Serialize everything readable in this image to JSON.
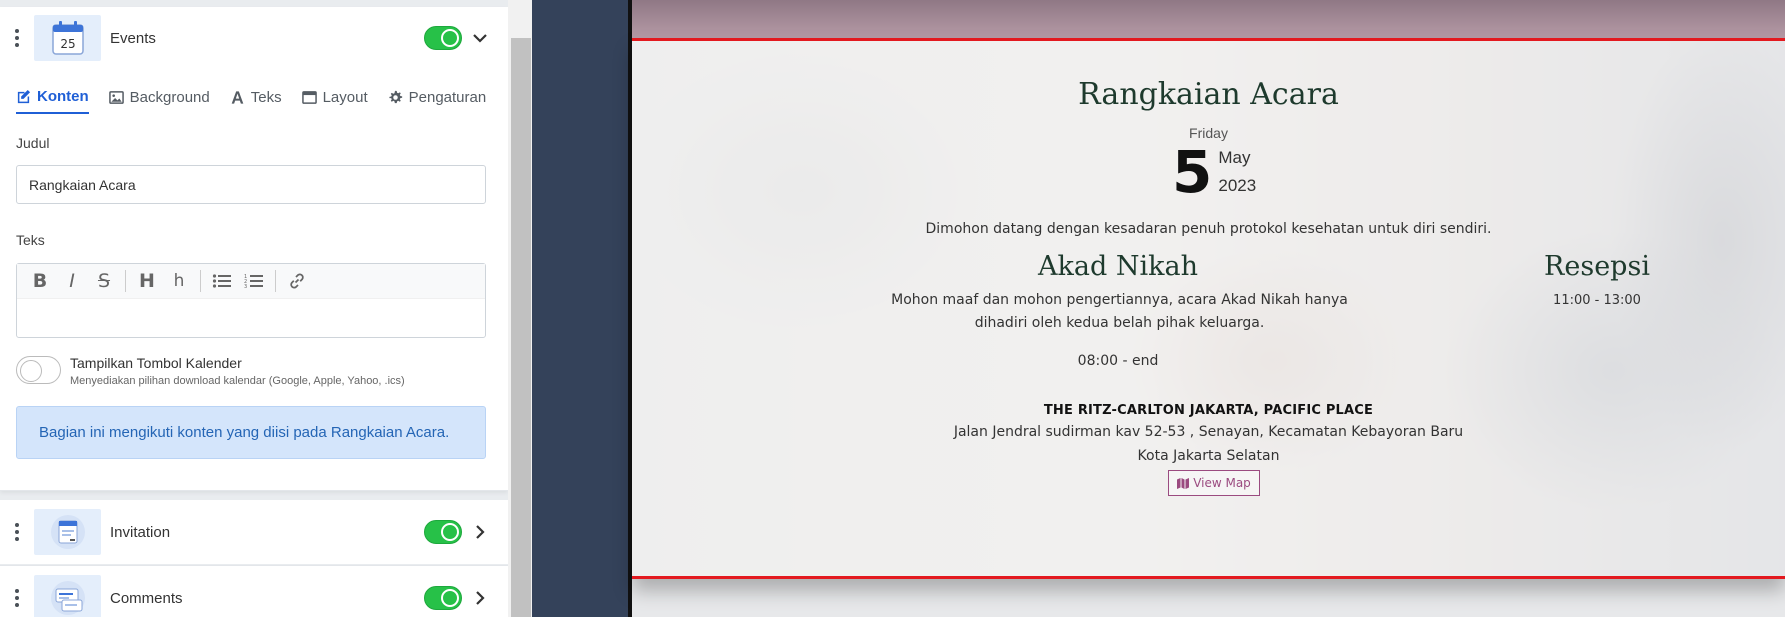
{
  "editor": {
    "section_events": {
      "name": "Events",
      "enabled": true,
      "thumb_day": "25"
    },
    "tabs": [
      {
        "label": "Konten",
        "icon": "edit-icon",
        "active": true
      },
      {
        "label": "Background",
        "icon": "image-icon",
        "active": false
      },
      {
        "label": "Teks",
        "icon": "font-icon",
        "active": false
      },
      {
        "label": "Layout",
        "icon": "window-icon",
        "active": false
      },
      {
        "label": "Pengaturan",
        "icon": "gear-icon",
        "active": false
      }
    ],
    "judul_label": "Judul",
    "judul_value": "Rangkaian Acara",
    "teks_label": "Teks",
    "toolbar_buttons": [
      "B",
      "I",
      "S",
      "H",
      "h",
      "bullet-list-icon",
      "numbered-list-icon",
      "link-icon"
    ],
    "calendar_toggle": {
      "title": "Tampilkan Tombol Kalender",
      "description": "Menyediakan pilihan download kalendar (Google, Apple, Yahoo, .ics)",
      "enabled": false
    },
    "info": {
      "prefix": "Bagian ini mengikuti konten yang diisi pada ",
      "link": "Rangkaian Acara",
      "suffix": "."
    },
    "section_invitation": {
      "name": "Invitation",
      "enabled": true
    },
    "section_comments": {
      "name": "Comments",
      "enabled": true
    }
  },
  "preview": {
    "title": "Rangkaian Acara",
    "day_name": "Friday",
    "day": "5",
    "month": "May",
    "year": "2023",
    "note": "Dimohon datang dengan kesadaran penuh protokol kesehatan untuk diri sendiri.",
    "akad": {
      "title": "Akad Nikah",
      "description": "Mohon maaf dan mohon pengertiannya, acara Akad Nikah hanya dihadiri oleh kedua belah pihak keluarga.",
      "time": "08:00 - end"
    },
    "resepsi": {
      "title": "Resepsi",
      "time": "11:00 - 13:00"
    },
    "venue": {
      "name": "THE RITZ-CARLTON JAKARTA, PACIFIC PLACE",
      "address": "Jalan Jendral sudirman kav 52-53 , Senayan, Kecamatan Kebayoran Baru",
      "city": "Kota Jakarta Selatan"
    },
    "map_button": "View Map"
  },
  "colors": {
    "accent": "#1f5fd6",
    "toggle_on": "#27c148",
    "frame_border": "#e3191f",
    "map_button": "#9b4b80"
  }
}
